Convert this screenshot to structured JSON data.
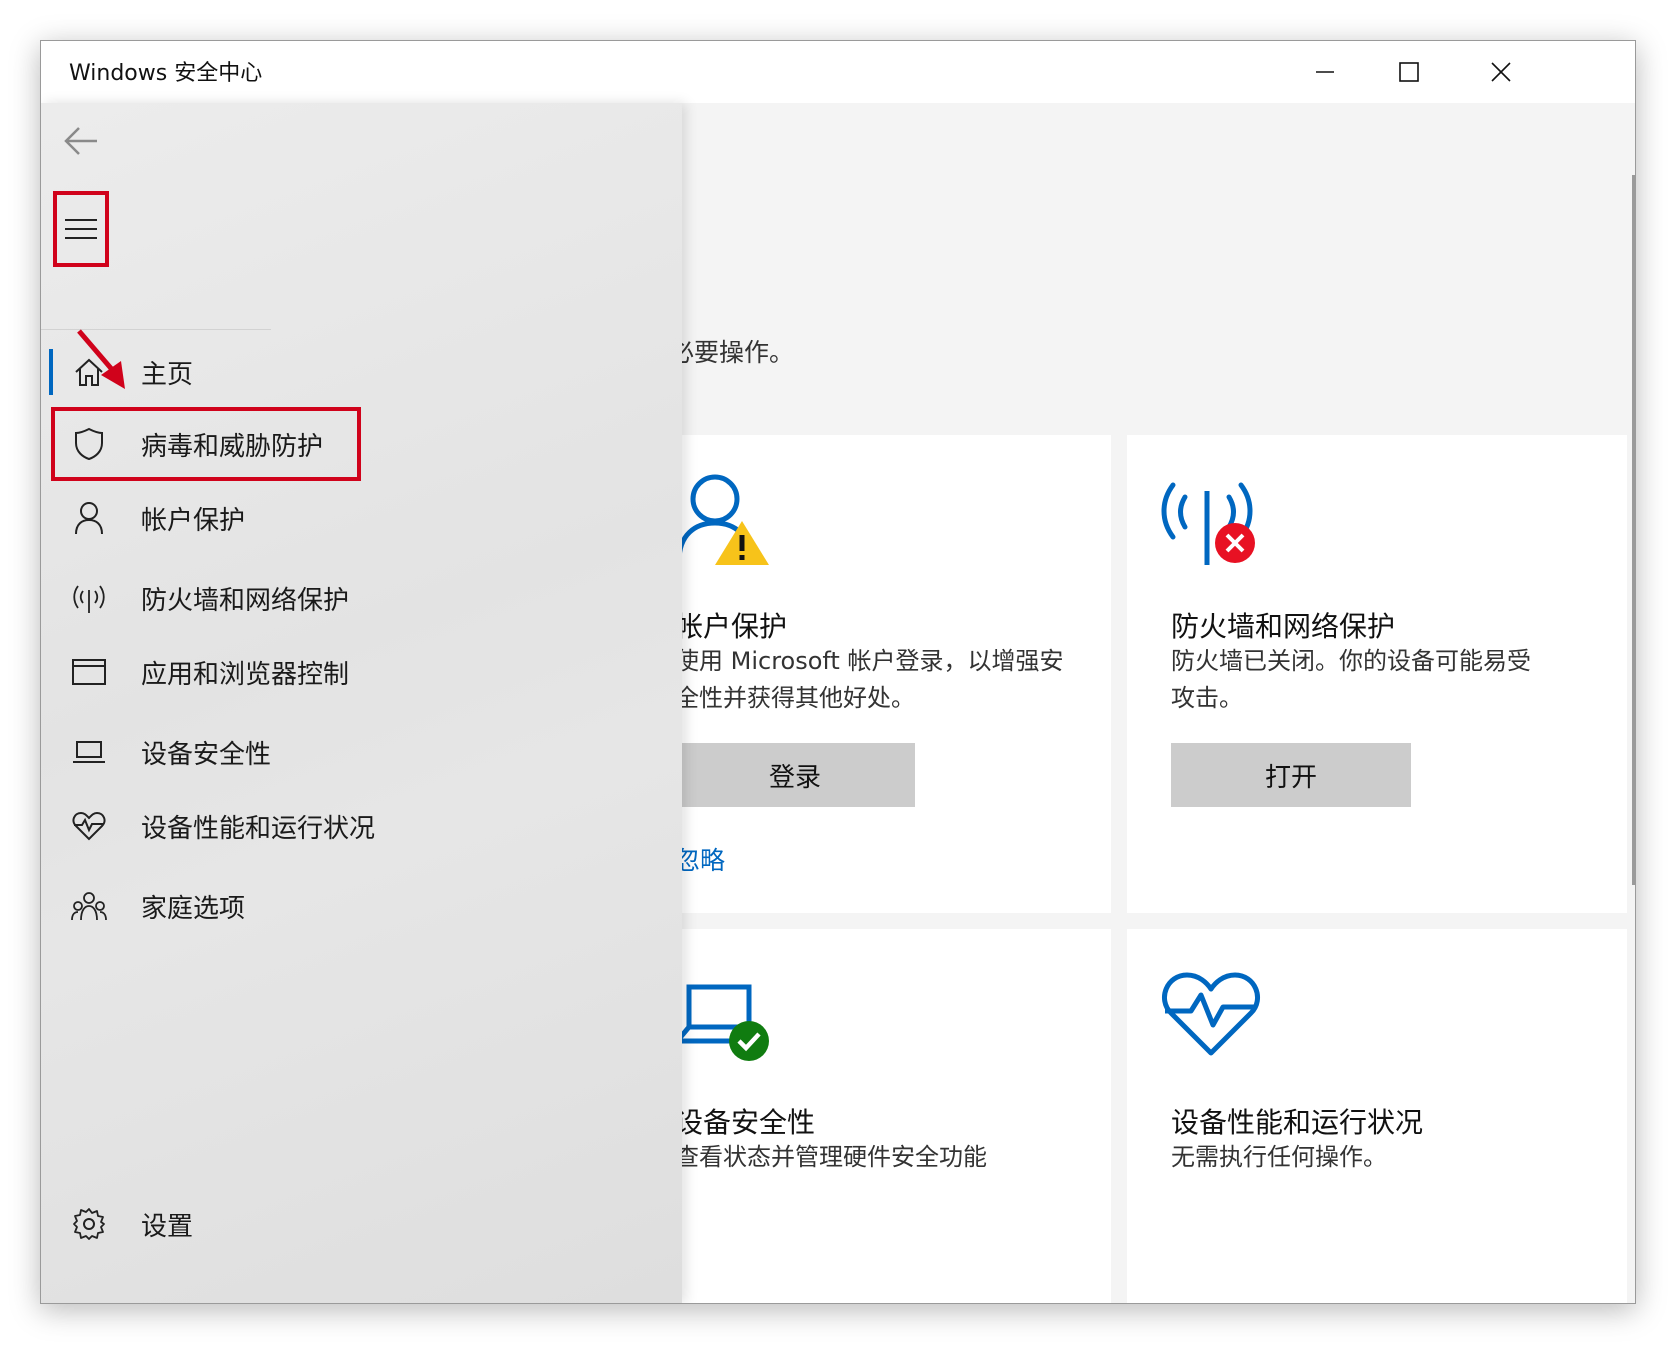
{
  "window": {
    "title": "Windows 安全中心",
    "controls": {
      "minimize": "minimize-icon",
      "maximize": "maximize-icon",
      "close": "close-icon"
    }
  },
  "main": {
    "hint_text": "必要操作。",
    "cards": [
      {
        "id": "account",
        "icon": "account-warning-icon",
        "title": "帐户保护",
        "description": "使用 Microsoft 帐户登录，以增强安全性并获得其他好处。",
        "button_label": "登录",
        "link_label": "忽略"
      },
      {
        "id": "firewall",
        "icon": "firewall-error-icon",
        "title": "防火墙和网络保护",
        "description": "防火墙已关闭。你的设备可能易受攻击。",
        "button_label": "打开"
      },
      {
        "id": "device-security",
        "icon": "laptop-ok-icon",
        "title": "设备安全性",
        "description": "查看状态并管理硬件安全功能"
      },
      {
        "id": "device-health",
        "icon": "heart-pulse-icon",
        "title": "设备性能和运行状况",
        "description": "无需执行任何操作。"
      }
    ]
  },
  "nav": {
    "back_icon": "back-arrow-icon",
    "menu_icon": "hamburger-icon",
    "items": [
      {
        "label": "主页",
        "icon": "home-icon",
        "active": true
      },
      {
        "label": "病毒和威胁防护",
        "icon": "shield-icon",
        "highlighted": true
      },
      {
        "label": "帐户保护",
        "icon": "person-icon"
      },
      {
        "label": "防火墙和网络保护",
        "icon": "antenna-icon"
      },
      {
        "label": "应用和浏览器控制",
        "icon": "browser-window-icon"
      },
      {
        "label": "设备安全性",
        "icon": "laptop-icon"
      },
      {
        "label": "设备性能和运行状况",
        "icon": "heart-icon"
      },
      {
        "label": "家庭选项",
        "icon": "family-icon"
      }
    ],
    "settings": {
      "label": "设置",
      "icon": "gear-icon"
    }
  },
  "colors": {
    "accent": "#0067c0",
    "annotation_red": "#d0021b",
    "warning_yellow": "#f7c31a",
    "error_red": "#e81123",
    "success_green": "#107c10",
    "button_gray": "#cccccc"
  }
}
